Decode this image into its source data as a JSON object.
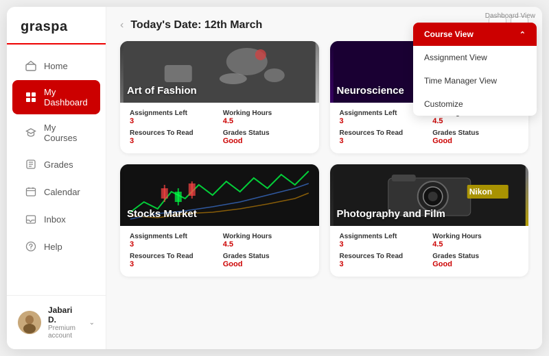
{
  "app": {
    "logo": "graspa"
  },
  "sidebar": {
    "items": [
      {
        "id": "home",
        "label": "Home",
        "icon": "home"
      },
      {
        "id": "dashboard",
        "label": "My Dashboard",
        "icon": "dashboard",
        "active": true
      },
      {
        "id": "courses",
        "label": "My Courses",
        "icon": "courses"
      },
      {
        "id": "grades",
        "label": "Grades",
        "icon": "grades"
      },
      {
        "id": "calendar",
        "label": "Calendar",
        "icon": "calendar"
      },
      {
        "id": "inbox",
        "label": "Inbox",
        "icon": "inbox"
      },
      {
        "id": "help",
        "label": "Help",
        "icon": "help"
      }
    ],
    "user": {
      "name": "Jabari D.",
      "role": "Premium account"
    }
  },
  "header": {
    "back_arrow": "‹",
    "date_label": "Today's Date: 12th March",
    "prev_arrow": "‹",
    "next_arrow": "›"
  },
  "dropdown": {
    "section_label": "Dashboard View",
    "items": [
      {
        "id": "course-view",
        "label": "Course View",
        "selected": true
      },
      {
        "id": "assignment-view",
        "label": "Assignment View",
        "selected": false
      },
      {
        "id": "time-manager",
        "label": "Time Manager View",
        "selected": false
      },
      {
        "id": "customize",
        "label": "Customize",
        "selected": false
      }
    ]
  },
  "courses": [
    {
      "id": "fashion",
      "title": "Art of Fashion",
      "bg_type": "fashion",
      "stats": {
        "assignments_left_label": "Assignments Left",
        "assignments_left_value": "3",
        "working_hours_label": "Working Hours",
        "working_hours_value": "4.5",
        "resources_label": "Resources To Read",
        "resources_value": "3",
        "grades_label": "Grades Status",
        "grades_value": "Good"
      }
    },
    {
      "id": "neuro",
      "title": "Neuroscience",
      "bg_type": "neuro",
      "stats": {
        "assignments_left_label": "Assignments Left",
        "assignments_left_value": "3",
        "working_hours_label": "Working Hours",
        "working_hours_value": "4.5",
        "resources_label": "Resources To Read",
        "resources_value": "3",
        "grades_label": "Grades Status",
        "grades_value": "Good"
      }
    },
    {
      "id": "stocks",
      "title": "Stocks Market",
      "bg_type": "stocks",
      "stats": {
        "assignments_left_label": "Assignments Left",
        "assignments_left_value": "3",
        "working_hours_label": "Working Hours",
        "working_hours_value": "4.5",
        "resources_label": "Resources To Read",
        "resources_value": "3",
        "grades_label": "Grades Status",
        "grades_value": "Good"
      }
    },
    {
      "id": "photo",
      "title": "Photography and Film",
      "bg_type": "photo",
      "stats": {
        "assignments_left_label": "Assignments Left",
        "assignments_left_value": "3",
        "working_hours_label": "Working Hours",
        "working_hours_value": "4.5",
        "resources_label": "Resources To Read",
        "resources_value": "3",
        "grades_label": "Grades Status",
        "grades_value": "Good"
      }
    }
  ],
  "colors": {
    "accent": "#cc0000",
    "active_nav_bg": "#cc0000"
  }
}
